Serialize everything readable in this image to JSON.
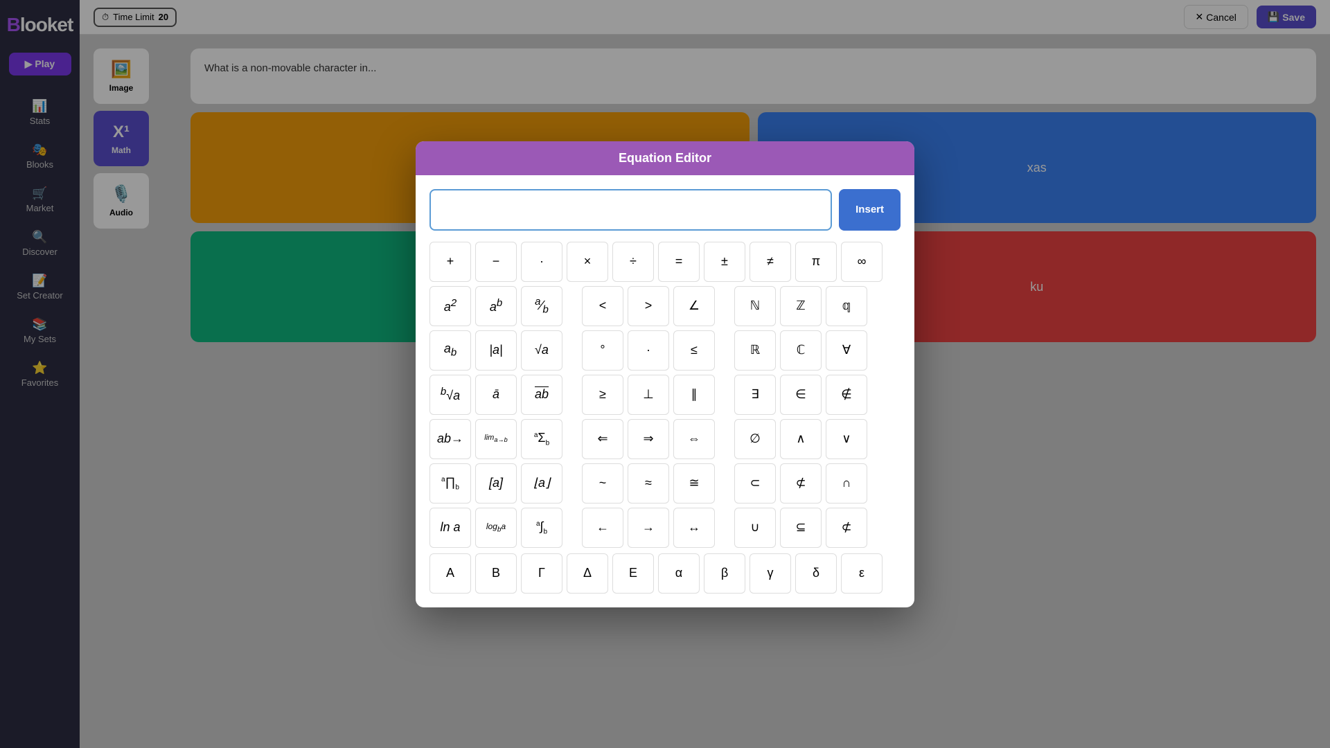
{
  "app": {
    "logo": "ooket",
    "logo_highlight": "B"
  },
  "sidebar": {
    "play_label": "▶ Play",
    "items": [
      {
        "label": "Stats",
        "icon": "📊"
      },
      {
        "label": "Blooks",
        "icon": "🎭"
      },
      {
        "label": "Market",
        "icon": "🛒"
      },
      {
        "label": "Discover",
        "icon": "🔍"
      },
      {
        "label": "Set Creator",
        "icon": "📝"
      },
      {
        "label": "My Sets",
        "icon": "📚"
      },
      {
        "label": "Favorites",
        "icon": "⭐"
      }
    ]
  },
  "topbar": {
    "time_limit_label": "Time Limit",
    "time_value": "20",
    "cancel_label": "Cancel",
    "save_label": "Save"
  },
  "tools": [
    {
      "label": "Image",
      "icon": "🖼️",
      "active": false
    },
    {
      "label": "Math",
      "icon": "X¹",
      "active": true
    },
    {
      "label": "Audio",
      "icon": "🎙️",
      "active": false
    }
  ],
  "eq_editor": {
    "title": "Equation Editor",
    "input_placeholder": "",
    "insert_label": "Insert",
    "rows": {
      "basic": [
        "+",
        "−",
        "·",
        "×",
        "÷",
        "=",
        "±",
        "≠",
        "π",
        "∞"
      ],
      "powers": [
        "a²",
        "aᵇ",
        "a/b",
        "<",
        ">",
        "∠",
        "",
        "ℕ",
        "ℤ",
        "𝕢"
      ],
      "subscript": [
        "aᵦ",
        "|a|",
        "√a",
        "°",
        "·",
        "≤",
        "",
        "ℝ",
        "ℂ",
        "∀"
      ],
      "root": [
        "ᵇ√a",
        "ā",
        "ab̄",
        "≥",
        "⊥",
        "∥",
        "",
        "∃",
        "∈",
        "∉"
      ],
      "arrows1": [
        "ab→",
        "lim a→b",
        "Σ",
        "⇐",
        "⇒",
        "⇔",
        "",
        "∅",
        "∧",
        "∨"
      ],
      "prod": [
        "∏",
        "[a]",
        "⌊a⌋",
        "~",
        "≈",
        "≅",
        "",
        "⊂",
        "⊄",
        "∩"
      ],
      "log": [
        "ln a",
        "logᵦa",
        "∫",
        "←",
        "→",
        "↔",
        "",
        "∪",
        "⊆",
        "⊄"
      ],
      "greek_upper": [
        "Α",
        "Β",
        "Γ",
        "Δ",
        "Ε",
        "",
        "α",
        "β",
        "γ",
        "δ",
        "ε"
      ]
    }
  }
}
